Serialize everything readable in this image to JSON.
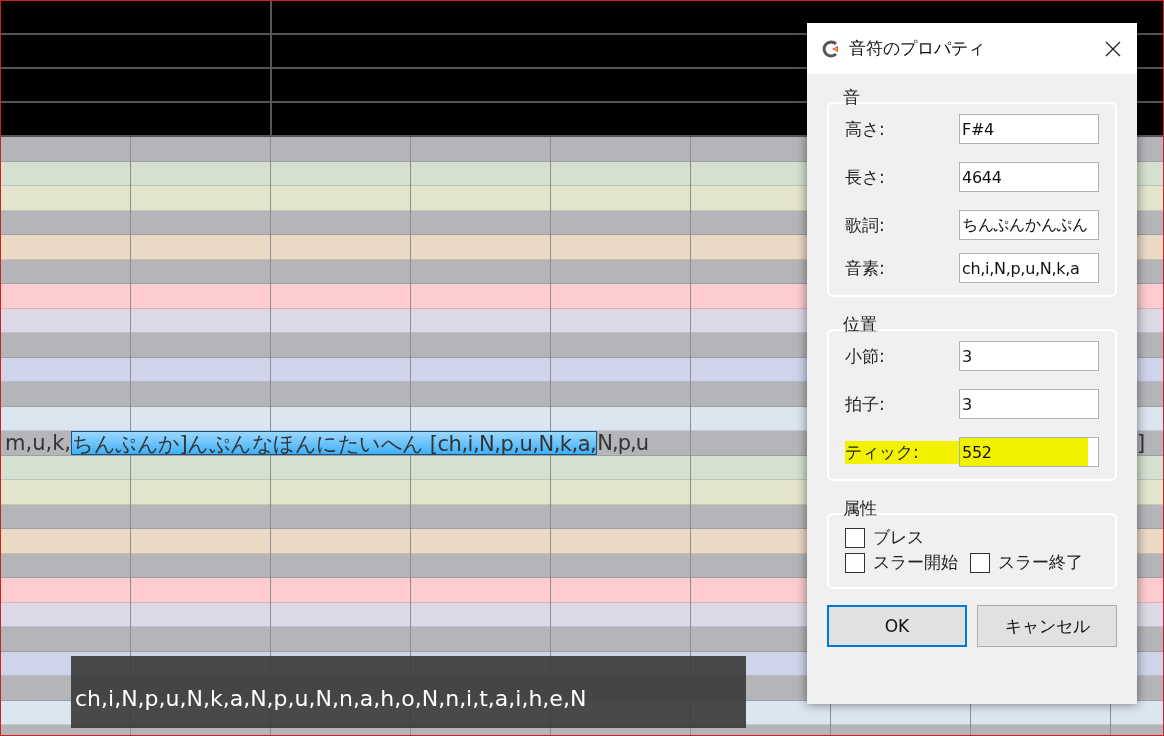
{
  "piano_roll": {
    "note_row": {
      "before": "m,u,k,",
      "note": "ちんぷんか]んぷんなほんにたいへん [ch,i,N,p,u,N,k,a,",
      "after": "N,p,u",
      "right": "]"
    },
    "tooltip": "ch,i,N,p,u,N,k,a,N,p,u,N,n,a,h,o,N,n,i,t,a,i,h,e,N"
  },
  "dialog": {
    "title": "音符のプロパティ",
    "groups": [
      {
        "title": "音",
        "kind": "fields",
        "fields": [
          {
            "label": "高さ:",
            "value": "F#4",
            "highlighted": false
          },
          {
            "label": "長さ:",
            "value": "4644",
            "highlighted": false
          },
          {
            "label": "歌詞:",
            "value": "ちんぷんかんぷん",
            "highlighted": false
          },
          {
            "label": "音素:",
            "value": "ch,i,N,p,u,N,k,a",
            "highlighted": false
          }
        ]
      },
      {
        "title": "位置",
        "kind": "fields",
        "fields": [
          {
            "label": "小節:",
            "value": "3",
            "highlighted": false
          },
          {
            "label": "拍子:",
            "value": "3",
            "highlighted": false
          },
          {
            "label": "ティック:",
            "value": "552",
            "highlighted": true
          }
        ]
      },
      {
        "title": "属性",
        "kind": "checks",
        "rows": [
          [
            {
              "label": "ブレス",
              "checked": false
            }
          ],
          [
            {
              "label": "スラー開始",
              "checked": false
            },
            {
              "label": "スラー終了",
              "checked": false
            }
          ]
        ]
      }
    ],
    "buttons": [
      {
        "label": "OK",
        "default": true
      },
      {
        "label": "キャンセル",
        "default": false
      }
    ]
  }
}
